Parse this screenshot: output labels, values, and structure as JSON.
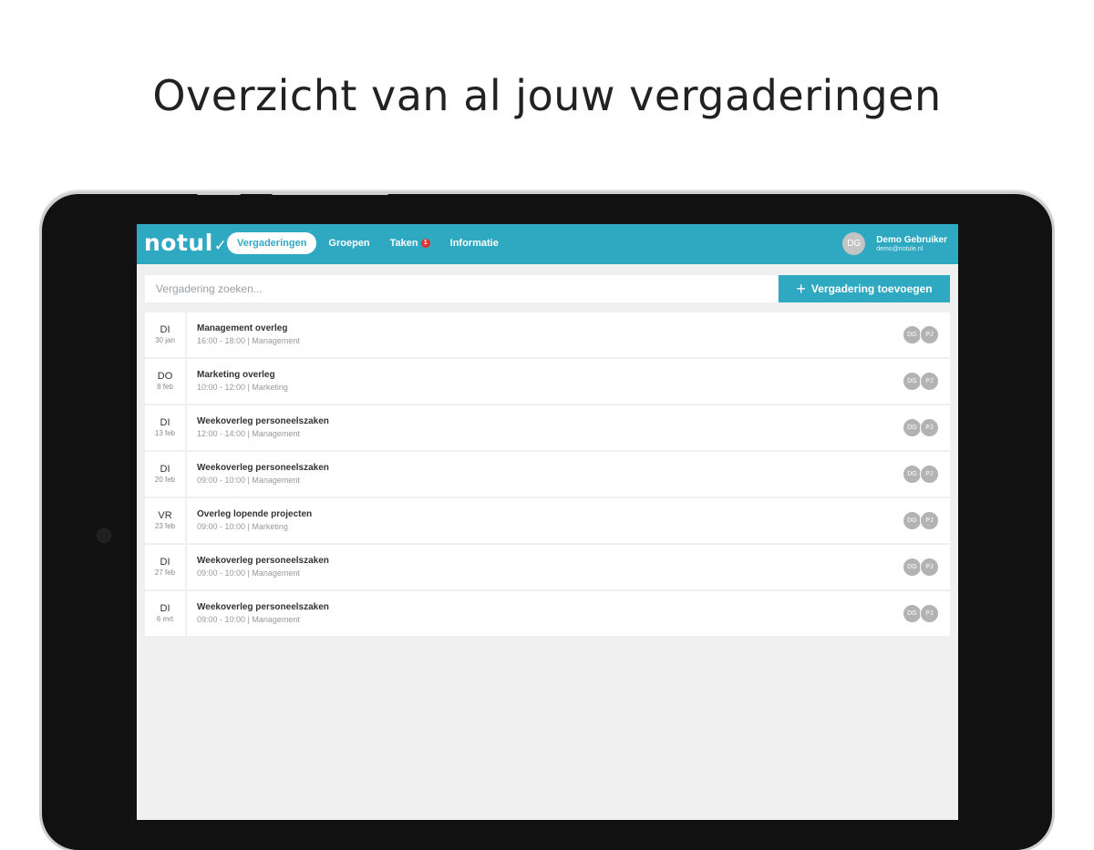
{
  "headline": "Overzicht van al jouw vergaderingen",
  "app": {
    "logo": "notul",
    "nav": [
      {
        "label": "Vergaderingen",
        "active": true
      },
      {
        "label": "Groepen",
        "active": false
      },
      {
        "label": "Taken",
        "active": false,
        "badge": "1"
      },
      {
        "label": "Informatie",
        "active": false
      }
    ],
    "user": {
      "initials": "DG",
      "name": "Demo Gebruiker",
      "email": "demo@notule.nl"
    },
    "search": {
      "placeholder": "Vergadering zoeken...",
      "value": ""
    },
    "add_button": "Vergadering toevoegen",
    "meetings": [
      {
        "day": "DI",
        "date": "30 jan",
        "title": "Management overleg",
        "meta": "16:00 - 18:00 | Management",
        "attendees": [
          "DG",
          "PJ"
        ]
      },
      {
        "day": "DO",
        "date": "8 feb",
        "title": "Marketing overleg",
        "meta": "10:00 - 12:00 | Marketing",
        "attendees": [
          "DG",
          "PJ"
        ]
      },
      {
        "day": "DI",
        "date": "13 feb",
        "title": "Weekoverleg personeelszaken",
        "meta": "12:00 - 14:00 | Management",
        "attendees": [
          "DG",
          "PJ"
        ]
      },
      {
        "day": "DI",
        "date": "20 feb",
        "title": "Weekoverleg personeelszaken",
        "meta": "09:00 - 10:00 | Management",
        "attendees": [
          "DG",
          "PJ"
        ]
      },
      {
        "day": "VR",
        "date": "23 feb",
        "title": "Overleg lopende projecten",
        "meta": "09:00 - 10:00 | Marketing",
        "attendees": [
          "DG",
          "PJ"
        ]
      },
      {
        "day": "DI",
        "date": "27 feb",
        "title": "Weekoverleg personeelszaken",
        "meta": "09:00 - 10:00 | Management",
        "attendees": [
          "DG",
          "PJ"
        ]
      },
      {
        "day": "DI",
        "date": "6 mrt",
        "title": "Weekoverleg personeelszaken",
        "meta": "09:00 - 10:00 | Management",
        "attendees": [
          "DG",
          "PJ"
        ]
      }
    ]
  },
  "colors": {
    "accent": "#2fa9c2",
    "badge": "#e3342f",
    "background": "#f0f0f0"
  }
}
